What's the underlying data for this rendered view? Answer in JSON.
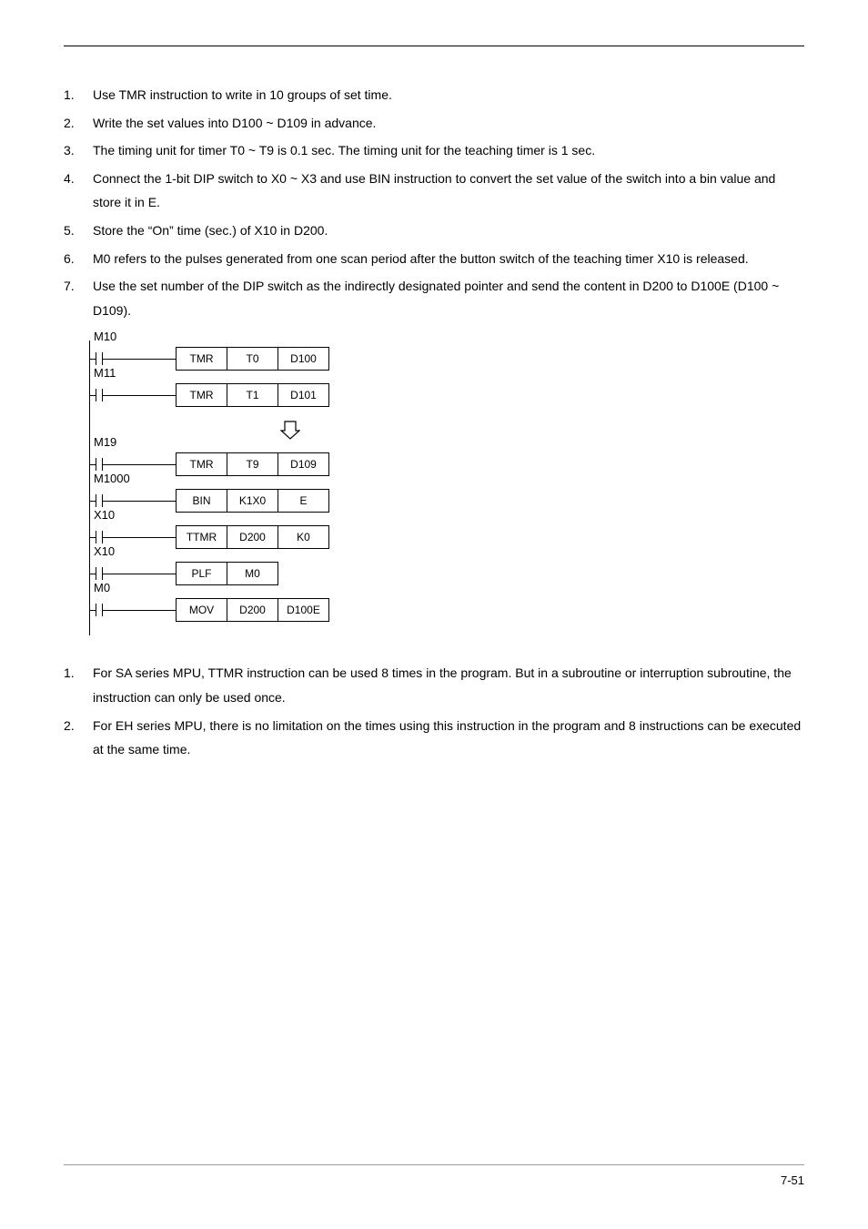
{
  "list1": [
    {
      "n": "1.",
      "t": "Use TMR instruction to write in 10 groups of set time."
    },
    {
      "n": "2.",
      "t": "Write the set values into D100 ~ D109 in advance."
    },
    {
      "n": "3.",
      "t": "The timing unit for timer T0 ~ T9 is 0.1 sec. The timing unit for the teaching timer is 1 sec."
    },
    {
      "n": "4.",
      "t": "Connect the 1-bit DIP switch to X0 ~ X3 and use BIN instruction to convert the set value of the switch into a bin value and store it in E."
    },
    {
      "n": "5.",
      "t": "Store the “On” time (sec.) of X10 in D200."
    },
    {
      "n": "6.",
      "t": "M0 refers to the pulses generated from one scan period after the button switch of the teaching timer X10 is released."
    },
    {
      "n": "7.",
      "t": "Use the set number of the DIP switch as the indirectly designated pointer and send the content in D200 to D100E (D100 ~ D109)."
    }
  ],
  "list2": [
    {
      "n": "1.",
      "t": "For SA series MPU, TTMR instruction can be used 8 times in the program. But in a subroutine or interruption subroutine, the instruction can only be used once."
    },
    {
      "n": "2.",
      "t": "For EH series MPU, there is no limitation on the times using this instruction in the program and 8 instructions can be executed at the same time."
    }
  ],
  "ladder": {
    "r1": {
      "label": "M10",
      "c": [
        "TMR",
        "T0",
        "D100"
      ]
    },
    "r2": {
      "label": "M11",
      "c": [
        "TMR",
        "T1",
        "D101"
      ]
    },
    "r3": {
      "label": "M19",
      "c": [
        "TMR",
        "T9",
        "D109"
      ]
    },
    "r4": {
      "label": "M1000",
      "c": [
        "BIN",
        "K1X0",
        "E"
      ]
    },
    "r5": {
      "label": "X10",
      "c": [
        "TTMR",
        "D200",
        "K0"
      ]
    },
    "r6": {
      "label": "X10",
      "c": [
        "PLF",
        "M0"
      ]
    },
    "r7": {
      "label": "M0",
      "c": [
        "MOV",
        "D200",
        "D100E"
      ]
    }
  },
  "pagenum": "7-51"
}
